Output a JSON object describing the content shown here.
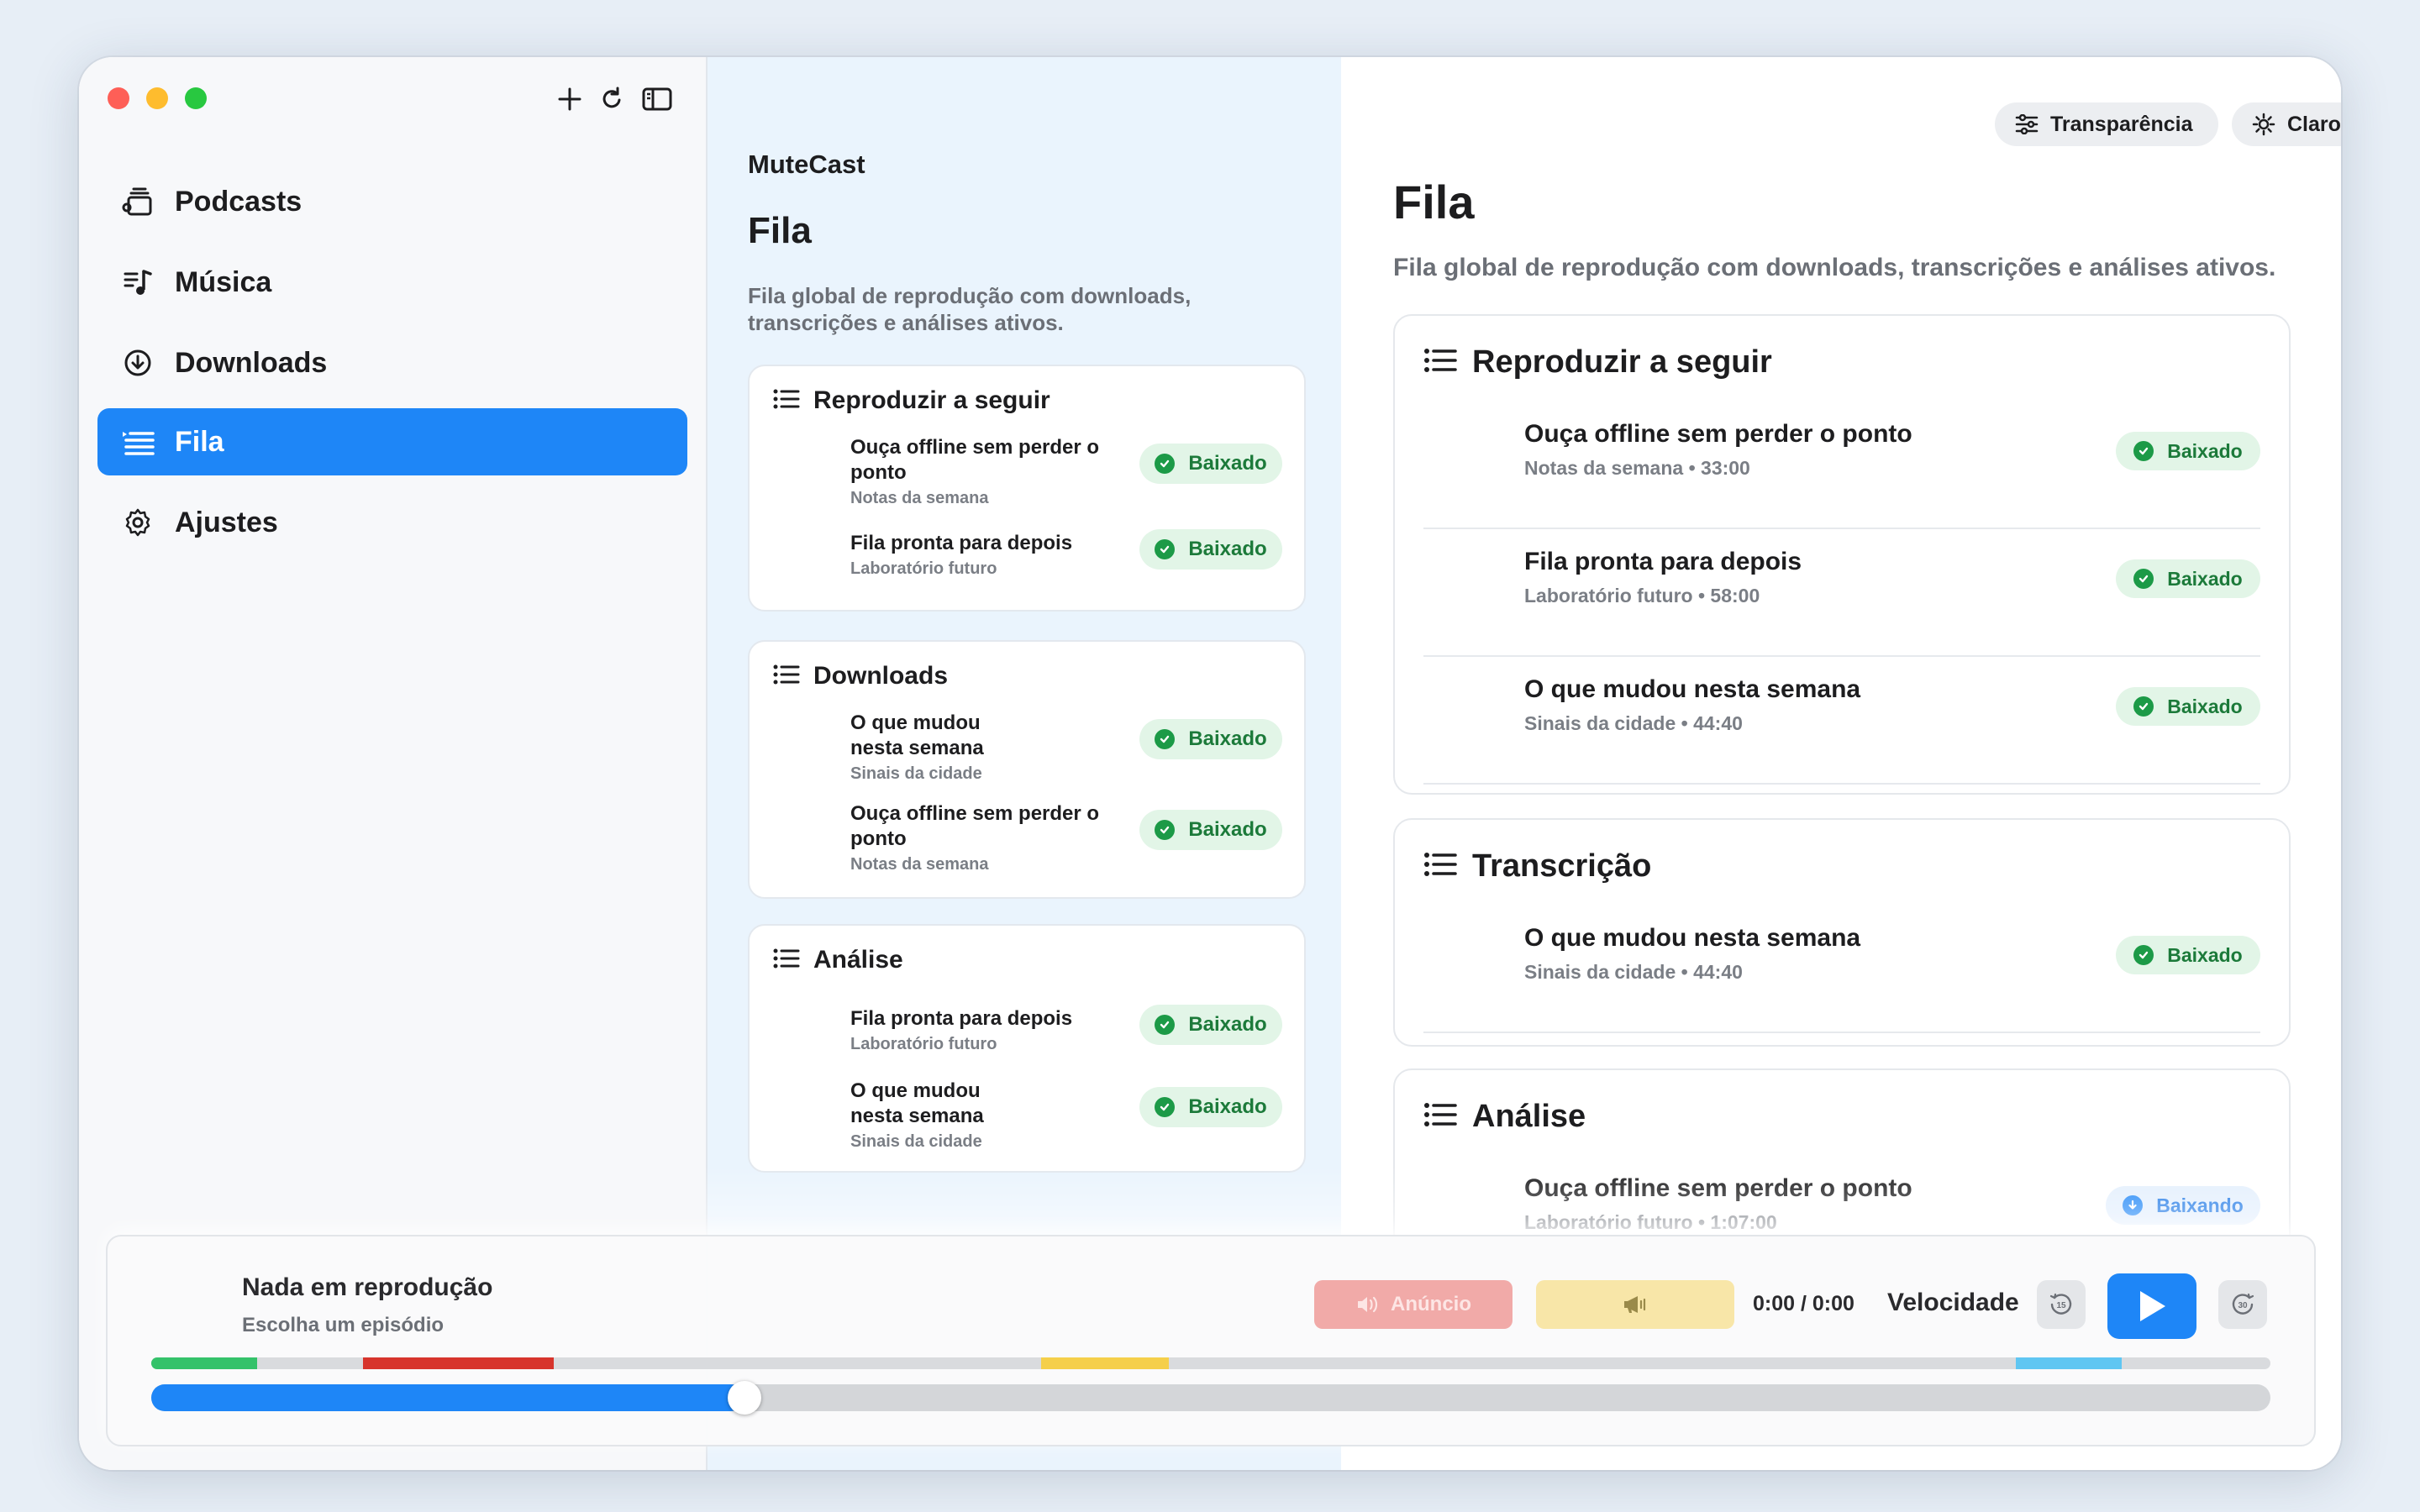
{
  "sidebar": {
    "toolbar": [
      "plus-icon",
      "refresh-icon",
      "sidebar-toggle-icon"
    ],
    "items": [
      {
        "label": "Podcasts",
        "icon": "podcasts-icon"
      },
      {
        "label": "Música",
        "icon": "music-icon"
      },
      {
        "label": "Downloads",
        "icon": "download-icon"
      },
      {
        "label": "Fila",
        "icon": "queue-icon",
        "active": true
      },
      {
        "label": "Ajustes",
        "icon": "gear-icon"
      }
    ]
  },
  "middle": {
    "app_name": "MuteCast",
    "title": "Fila",
    "subtitle": "Fila global de reprodução com downloads, transcrições e análises ativos.",
    "sections": [
      {
        "title": "Reproduzir a seguir",
        "items": [
          {
            "title": "Ouça offline sem perder o ponto",
            "subtitle": "Notas da semana",
            "status": "Baixado"
          },
          {
            "title": "Fila pronta para depois",
            "subtitle": "Laboratório futuro",
            "status": "Baixado"
          }
        ]
      },
      {
        "title": "Downloads",
        "items": [
          {
            "title": "O que mudou nesta semana",
            "subtitle": "Sinais da cidade",
            "status": "Baixado"
          },
          {
            "title": "Ouça offline sem perder o ponto",
            "subtitle": "Notas da semana",
            "status": "Baixado"
          }
        ]
      },
      {
        "title": "Análise",
        "items": [
          {
            "title": "Fila pronta para depois",
            "subtitle": "Laboratório futuro",
            "status": "Baixado"
          },
          {
            "title": "O que mudou nesta semana",
            "subtitle": "Sinais da cidade",
            "status": "Baixado"
          }
        ]
      }
    ]
  },
  "right": {
    "transparency_label": "Transparência",
    "theme_label": "Claro",
    "title": "Fila",
    "subtitle": "Fila global de reprodução com downloads, transcrições e análises ativos.",
    "sections": [
      {
        "title": "Reproduzir a seguir",
        "items": [
          {
            "title": "Ouça offline sem perder o ponto",
            "subtitle": "Notas da semana • 33:00",
            "status": "Baixado"
          },
          {
            "title": "Fila pronta para depois",
            "subtitle": "Laboratório futuro • 58:00",
            "status": "Baixado"
          },
          {
            "title": "O que mudou nesta semana",
            "subtitle": "Sinais da cidade • 44:40",
            "status": "Baixado"
          }
        ]
      },
      {
        "title": "Transcrição",
        "items": [
          {
            "title": "O que mudou nesta semana",
            "subtitle": "Sinais da cidade • 44:40",
            "status": "Baixado"
          }
        ]
      },
      {
        "title": "Análise",
        "items": [
          {
            "title": "Ouça offline sem perder o ponto",
            "subtitle": "Laboratório futuro • 1:07:00",
            "status": "Baixando"
          }
        ]
      }
    ]
  },
  "player": {
    "title": "Nada em reprodução",
    "subtitle": "Escolha um episódio",
    "ad_label": "Anúncio",
    "time": "0:00 / 0:00",
    "speed_label": "Velocidade",
    "skip_back_label": "15",
    "skip_forward_label": "30",
    "progress_percent": 28,
    "segments": [
      {
        "start": 0,
        "end": 0.05,
        "color": "#34c26a"
      },
      {
        "start": 0.1,
        "end": 0.19,
        "color": "#d7342c"
      },
      {
        "start": 0.42,
        "end": 0.48,
        "color": "#f5cf4a"
      },
      {
        "start": 0.88,
        "end": 0.93,
        "color": "#5fc6f2"
      }
    ]
  },
  "colors": {
    "accent": "#1e86f7",
    "success": "#1c9a47",
    "success_bg": "#e2f5e7"
  }
}
